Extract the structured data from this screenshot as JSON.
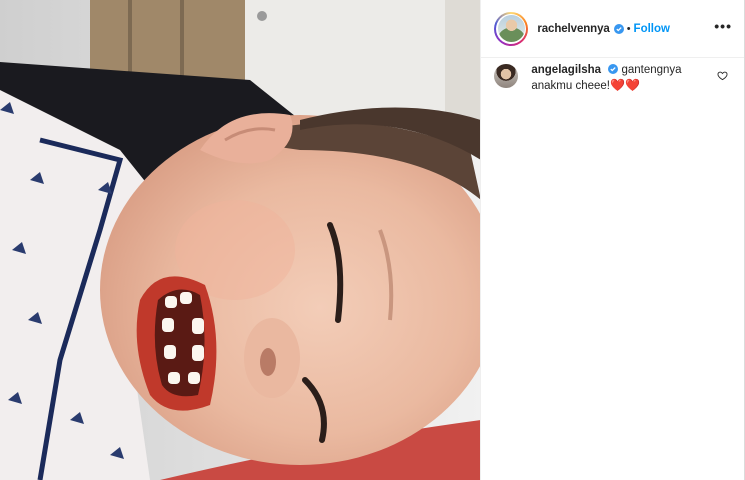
{
  "post": {
    "header": {
      "username": "rachelvennya",
      "separator": "•",
      "follow_label": "Follow",
      "more_label": "•••"
    },
    "comments": [
      {
        "username": "angelagilsha",
        "text": "gantengnya anakmu cheee!",
        "emoji": "❤️❤️"
      }
    ]
  },
  "colors": {
    "accent": "#0095f6",
    "verified": "#3897f0",
    "heart": "#e0245e"
  }
}
